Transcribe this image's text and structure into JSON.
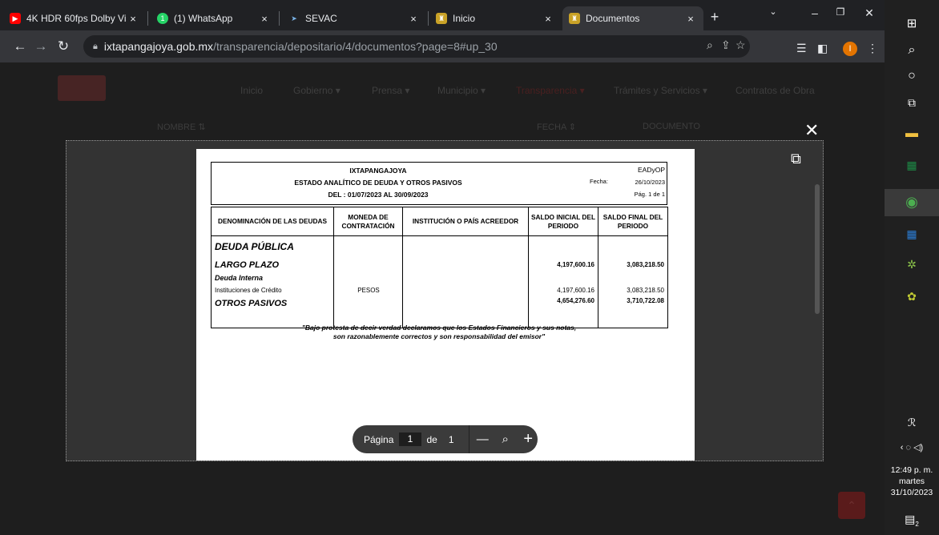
{
  "tabs": [
    {
      "title": "4K HDR 60fps Dolby Visi",
      "icon": "youtube-icon"
    },
    {
      "title": "(1) WhatsApp",
      "icon": "whatsapp-icon"
    },
    {
      "title": "SEVAC",
      "icon": "sevac-icon"
    },
    {
      "title": "Inicio",
      "icon": "site-icon"
    },
    {
      "title": "Documentos",
      "icon": "site-icon"
    }
  ],
  "address": {
    "host": "ixtapangajoya.gob.mx",
    "path": "/transparencia/depositario/4/documentos?page=8#up_30"
  },
  "profile_initial": "I",
  "site_nav": [
    "Inicio",
    "Gobierno ▾",
    "Prensa ▾",
    "Municipio ▾",
    "Transparencia ▾",
    "Trámites y Servicios ▾",
    "Contratos de Obra"
  ],
  "table_header": {
    "nombre": "NOMBRE ⇅",
    "fecha": "FECHA ⇕",
    "documento": "DOCUMENTO"
  },
  "document": {
    "entity": "IXTAPANGAJOYA",
    "title": "ESTADO ANALÍTICO DE DEUDA Y OTROS PASIVOS",
    "period": "DEL : 01/07/2023 AL 30/09/2023",
    "code": "EADyOP",
    "fecha_label": "Fecha:",
    "fecha": "26/10/2023",
    "page": "Pág. 1 de 1",
    "columns": [
      "DENOMINACIÓN DE LAS DEUDAS",
      "MONEDA DE CONTRATACIÓN",
      "INSTITUCIÓN O PAÍS ACREEDOR",
      "SALDO INICIAL DEL PERIODO",
      "SALDO FINAL DEL PERIODO"
    ],
    "rows": {
      "deuda_publica": "DEUDA PÚBLICA",
      "largo_plazo": "LARGO PLAZO",
      "largo_ini": "4,197,600.16",
      "largo_fin": "3,083,218.50",
      "deuda_interna": "Deuda Interna",
      "instituciones": "Instituciones de Crédito",
      "moneda": "PESOS",
      "inst_ini": "4,197,600.16",
      "inst_fin": "3,083,218.50",
      "otros_pasivos": "OTROS PASIVOS",
      "otros_ini": "4,654,276.60",
      "otros_fin": "3,710,722.08"
    },
    "note_line1": "\"Bajo protesta de decir verdad declaramos que los Estados Financieros y sus notas,",
    "note_line2": "son razonablemente correctos y son responsabilidad del emisor\""
  },
  "pager": {
    "label": "Página",
    "current": "1",
    "of": "de",
    "total": "1"
  },
  "clock": {
    "time": "12:49 p. m.",
    "day": "martes",
    "date": "31/10/2023"
  },
  "notifications": "2"
}
